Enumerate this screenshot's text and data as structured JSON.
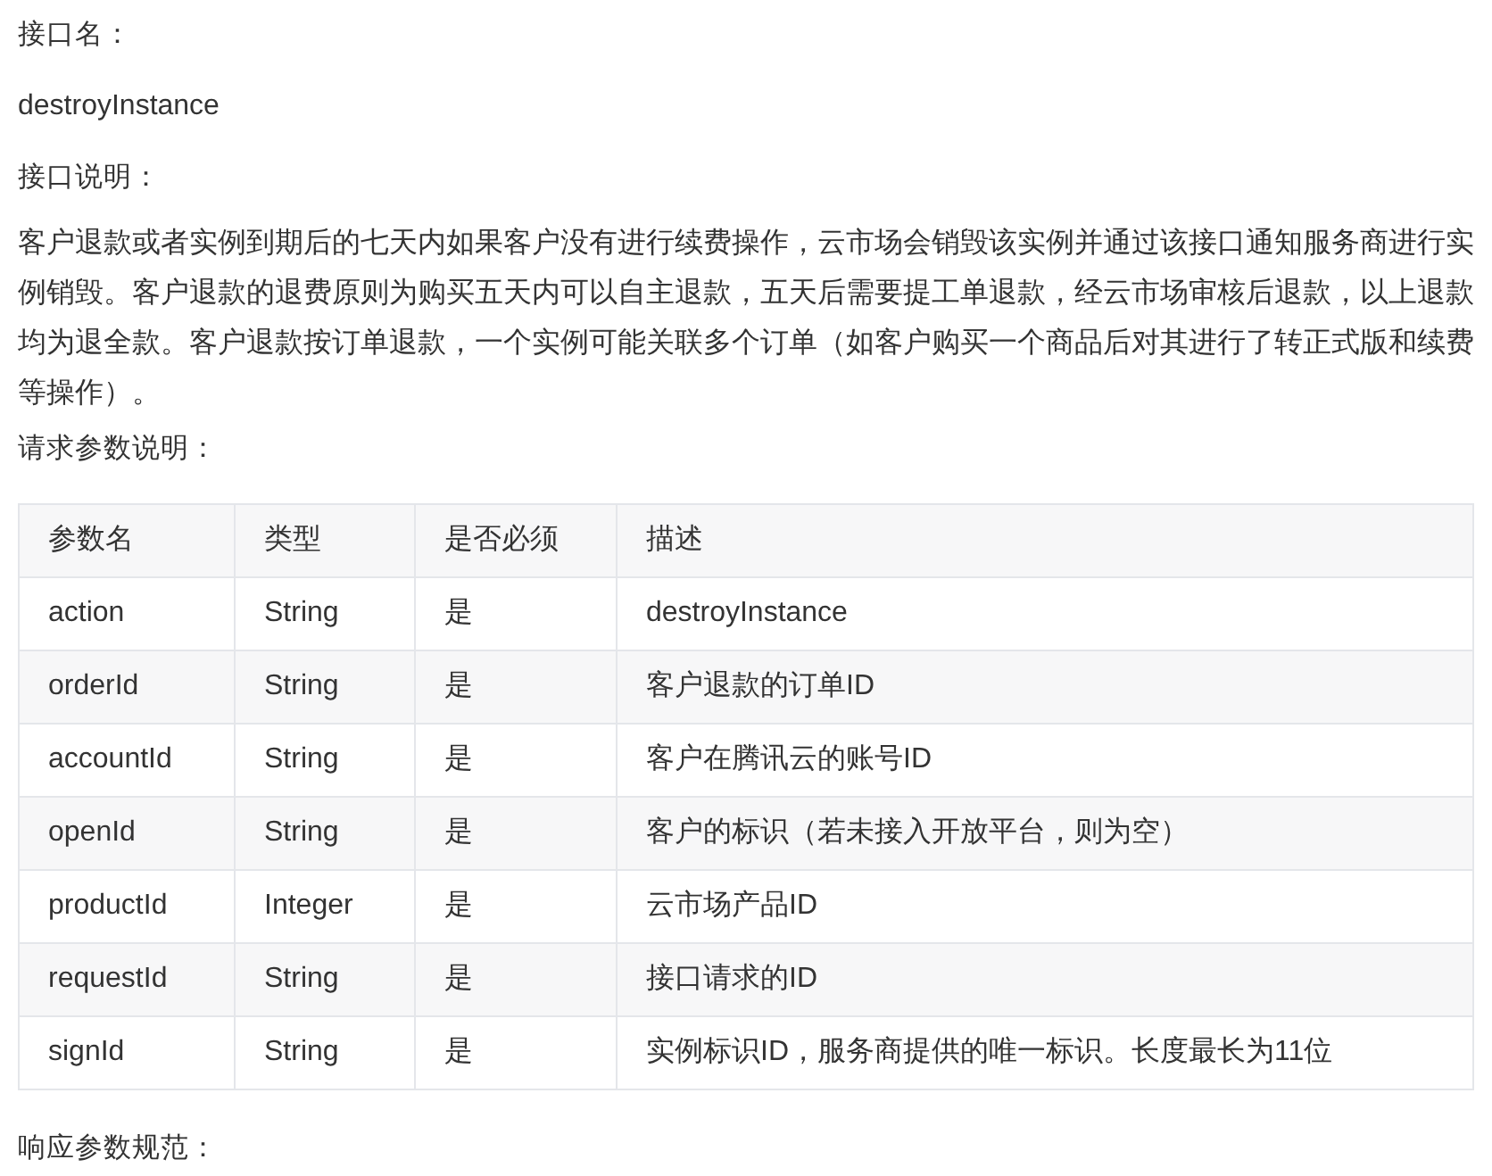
{
  "interface_name_label": "接口名：",
  "interface_name": "destroyInstance",
  "description_label": "接口说明：",
  "description": "客户退款或者实例到期后的七天内如果客户没有进行续费操作，云市场会销毁该实例并通过该接口通知服务商进行实例销毁。客户退款的退费原则为购买五天内可以自主退款，五天后需要提工单退款，经云市场审核后退款，以上退款均为退全款。客户退款按订单退款，一个实例可能关联多个订单（如客户购买一个商品后对其进行了转正式版和续费等操作）。",
  "request_params_label": "请求参数说明：",
  "table": {
    "columns": [
      "参数名",
      "类型",
      "是否必须",
      "描述"
    ],
    "rows": [
      [
        "action",
        "String",
        "是",
        "destroyInstance"
      ],
      [
        "orderId",
        "String",
        "是",
        "客户退款的订单ID"
      ],
      [
        "accountId",
        "String",
        "是",
        "客户在腾讯云的账号ID"
      ],
      [
        "openId",
        "String",
        "是",
        "客户的标识（若未接入开放平台，则为空）"
      ],
      [
        "productId",
        "Integer",
        "是",
        "云市场产品ID"
      ],
      [
        "requestId",
        "String",
        "是",
        "接口请求的ID"
      ],
      [
        "signId",
        "String",
        "是",
        "实例标识ID，服务商提供的唯一标识。长度最长为11位"
      ]
    ]
  },
  "response_params_label": "响应参数规范："
}
